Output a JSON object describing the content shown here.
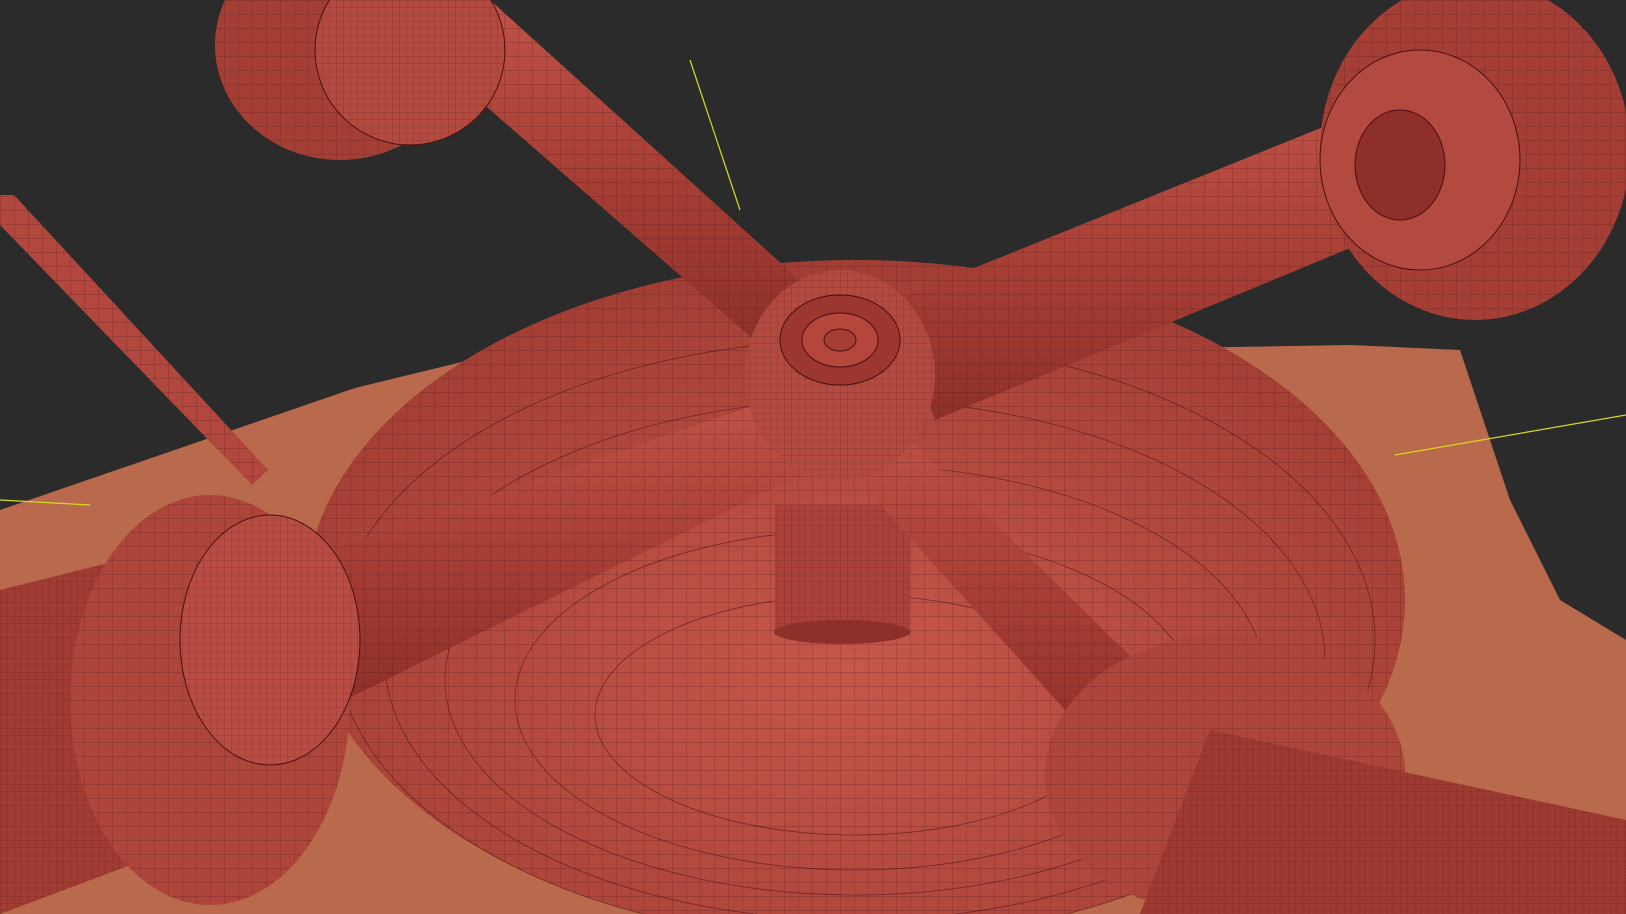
{
  "viewport": {
    "label": "",
    "shading": "wireframe-over-shaded",
    "background_color": "#2b2b2b",
    "mesh_color": "#b4463c",
    "ground_color": "#b9694c",
    "axis_line_color": "#d8d820",
    "wire_color": "#4a0f0f"
  },
  "scene_objects": [
    {
      "name": "dome-base"
    },
    {
      "name": "central-hub"
    },
    {
      "name": "hub-neck"
    },
    {
      "name": "arm-upper-left"
    },
    {
      "name": "arm-upper-right"
    },
    {
      "name": "arm-lower-left"
    },
    {
      "name": "arm-lower-right"
    },
    {
      "name": "flange-upper-left"
    },
    {
      "name": "flange-upper-right"
    },
    {
      "name": "flange-lower-left"
    },
    {
      "name": "flange-lower-right"
    },
    {
      "name": "thin-rod"
    },
    {
      "name": "ground-plane"
    }
  ]
}
